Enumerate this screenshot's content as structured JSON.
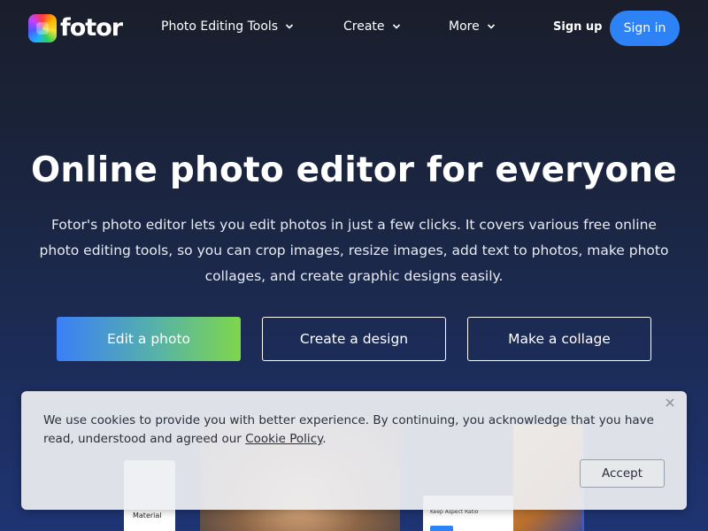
{
  "nav": {
    "logo_text": "fotor",
    "items": [
      {
        "label": "Photo Editing Tools"
      },
      {
        "label": "Create"
      },
      {
        "label": "More"
      }
    ],
    "signup_label": "Sign up",
    "signin_label": "Sign in"
  },
  "hero": {
    "title": "Online photo editor for everyone",
    "description": "Fotor's photo editor lets you edit photos in just a few clicks. It covers various free online photo editing tools, so you can crop images, resize images, add text to photos, make photo collages, and create graphic designs easily.",
    "buttons": {
      "edit": "Edit a photo",
      "design": "Create a design",
      "collage": "Make a collage"
    }
  },
  "preview": {
    "left_panel_label": "Material",
    "right_panel_label": "Keep Aspect Ratio"
  },
  "cookie": {
    "text": "We use cookies to provide you with better experience. By continuing, you acknowledge that you have read, understood and agreed our ",
    "link_text": "Cookie Policy",
    "suffix": ".",
    "accept_label": "Accept"
  },
  "colors": {
    "accent": "#2d83f5",
    "gradient_start": "#3b7ff7",
    "gradient_end": "#7fd64c"
  },
  "icons": {
    "dropdown": "chevron-down-icon",
    "close": "close-icon"
  }
}
